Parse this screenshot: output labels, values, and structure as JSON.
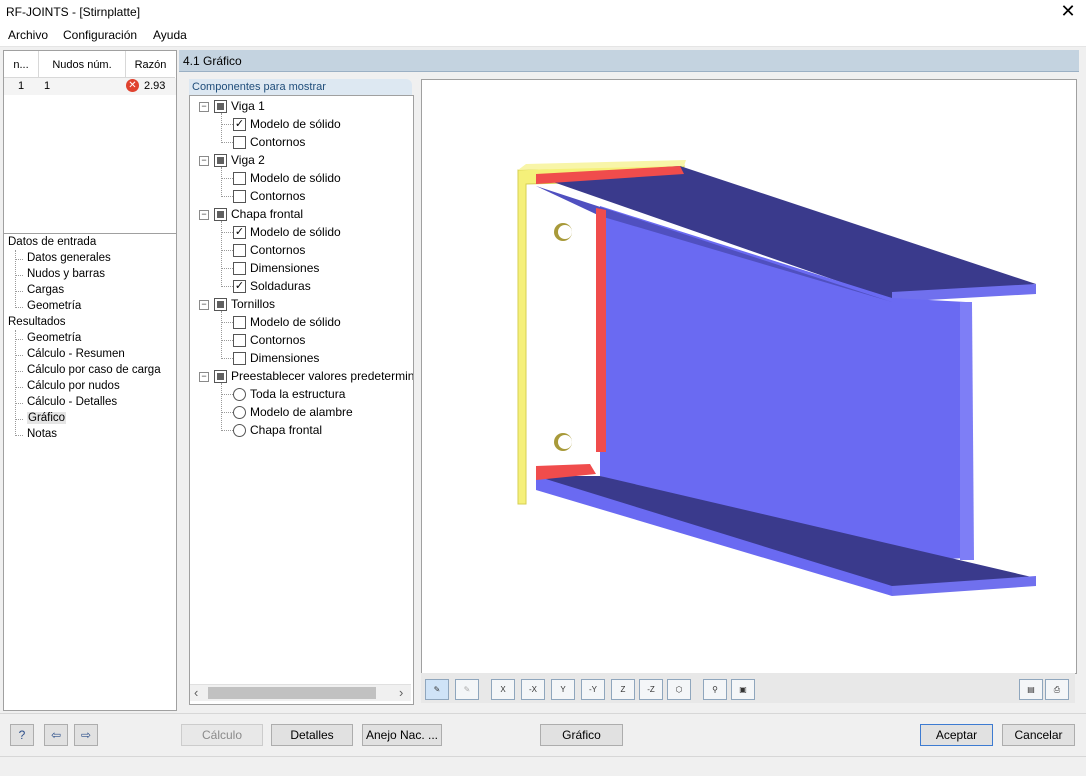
{
  "window": {
    "title": "RF-JOINTS - [Stirnplatte]"
  },
  "menu": [
    "Archivo",
    "Configuración",
    "Ayuda"
  ],
  "table": {
    "headers": [
      "n...",
      "Nudos núm.",
      "Razón"
    ],
    "rows": [
      {
        "n": "1",
        "nudos": "1",
        "razon": "2.93"
      }
    ]
  },
  "nav": {
    "input_label": "Datos de entrada",
    "input_items": [
      "Datos generales",
      "Nudos y barras",
      "Cargas",
      "Geometría"
    ],
    "results_label": "Resultados",
    "results_items": [
      "Geometría",
      "Cálculo - Resumen",
      "Cálculo por caso de carga",
      "Cálculo por nudos",
      "Cálculo - Detalles",
      "Gráfico",
      "Notas"
    ],
    "selected": "Gráfico"
  },
  "section_title": "4.1 Gráfico",
  "components": {
    "panel_title": "Componentes para mostrar",
    "groups": [
      {
        "label": "Viga 1",
        "items": [
          {
            "label": "Modelo de sólido",
            "checked": true
          },
          {
            "label": "Contornos",
            "checked": false
          }
        ]
      },
      {
        "label": "Viga 2",
        "items": [
          {
            "label": "Modelo de sólido",
            "checked": false
          },
          {
            "label": "Contornos",
            "checked": false
          }
        ]
      },
      {
        "label": "Chapa frontal",
        "items": [
          {
            "label": "Modelo de sólido",
            "checked": true
          },
          {
            "label": "Contornos",
            "checked": false
          },
          {
            "label": "Dimensiones",
            "checked": false
          },
          {
            "label": "Soldaduras",
            "checked": true
          }
        ]
      },
      {
        "label": "Tornillos",
        "items": [
          {
            "label": "Modelo de sólido",
            "checked": false
          },
          {
            "label": "Contornos",
            "checked": false
          },
          {
            "label": "Dimensiones",
            "checked": false
          }
        ]
      }
    ],
    "preset": {
      "label": "Preestablecer valores predetermina",
      "options": [
        "Toda la estructura",
        "Modelo de alambre",
        "Chapa frontal"
      ]
    }
  },
  "graphics": {
    "colors": {
      "beam": "#6a6af2",
      "beam_dark": "#3a3a8c",
      "end_plate": "#f5f07a",
      "weld": "#f04c4c"
    }
  },
  "gfx_toolbar": [
    "X",
    "-X",
    "Y",
    "-Y",
    "Z",
    "-Z"
  ],
  "buttons": {
    "calc": "Cálculo",
    "details": "Detalles",
    "annex": "Anejo Nac. ...",
    "graphic": "Gráfico",
    "ok": "Aceptar",
    "cancel": "Cancelar"
  }
}
